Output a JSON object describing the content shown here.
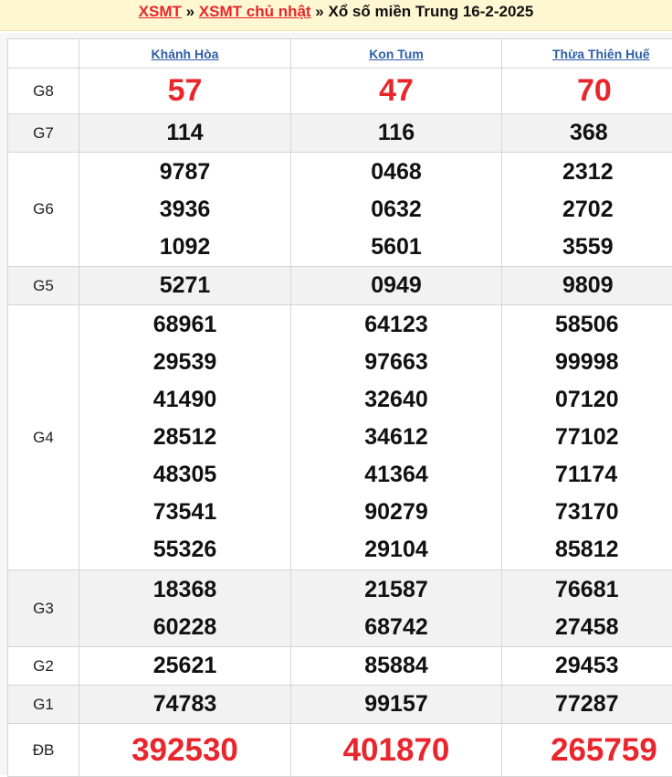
{
  "breadcrumb": {
    "link1": "XSMT",
    "sep1": " » ",
    "link2": "XSMT chủ nhật",
    "sep2": " » ",
    "title": "Xổ số miền Trung 16-2-2025"
  },
  "provinces": [
    "Khánh Hòa",
    "Kon Tum",
    "Thừa Thiên Huế"
  ],
  "prizes": [
    {
      "label": "G8",
      "style": "red",
      "rows": 1,
      "values": [
        [
          "57"
        ],
        [
          "47"
        ],
        [
          "70"
        ]
      ]
    },
    {
      "label": "G7",
      "style": "normal",
      "rows": 1,
      "values": [
        [
          "114"
        ],
        [
          "116"
        ],
        [
          "368"
        ]
      ]
    },
    {
      "label": "G6",
      "style": "normal",
      "rows": 3,
      "values": [
        [
          "9787",
          "3936",
          "1092"
        ],
        [
          "0468",
          "0632",
          "5601"
        ],
        [
          "2312",
          "2702",
          "3559"
        ]
      ]
    },
    {
      "label": "G5",
      "style": "normal",
      "rows": 1,
      "values": [
        [
          "5271"
        ],
        [
          "0949"
        ],
        [
          "9809"
        ]
      ]
    },
    {
      "label": "G4",
      "style": "normal",
      "rows": 7,
      "values": [
        [
          "68961",
          "29539",
          "41490",
          "28512",
          "48305",
          "73541",
          "55326"
        ],
        [
          "64123",
          "97663",
          "32640",
          "34612",
          "41364",
          "90279",
          "29104"
        ],
        [
          "58506",
          "99998",
          "07120",
          "77102",
          "71174",
          "73170",
          "85812"
        ]
      ]
    },
    {
      "label": "G3",
      "style": "normal",
      "rows": 2,
      "values": [
        [
          "18368",
          "60228"
        ],
        [
          "21587",
          "68742"
        ],
        [
          "76681",
          "27458"
        ]
      ]
    },
    {
      "label": "G2",
      "style": "normal",
      "rows": 1,
      "values": [
        [
          "25621"
        ],
        [
          "85884"
        ],
        [
          "29453"
        ]
      ]
    },
    {
      "label": "G1",
      "style": "normal",
      "rows": 1,
      "values": [
        [
          "74783"
        ],
        [
          "99157"
        ],
        [
          "77287"
        ]
      ]
    },
    {
      "label": "ĐB",
      "style": "db",
      "rows": 1,
      "values": [
        [
          "392530"
        ],
        [
          "401870"
        ],
        [
          "265759"
        ]
      ]
    }
  ],
  "colors": {
    "accent": "#e8262c",
    "link": "#2d5ea8",
    "header_bg": "#fff7d1"
  }
}
